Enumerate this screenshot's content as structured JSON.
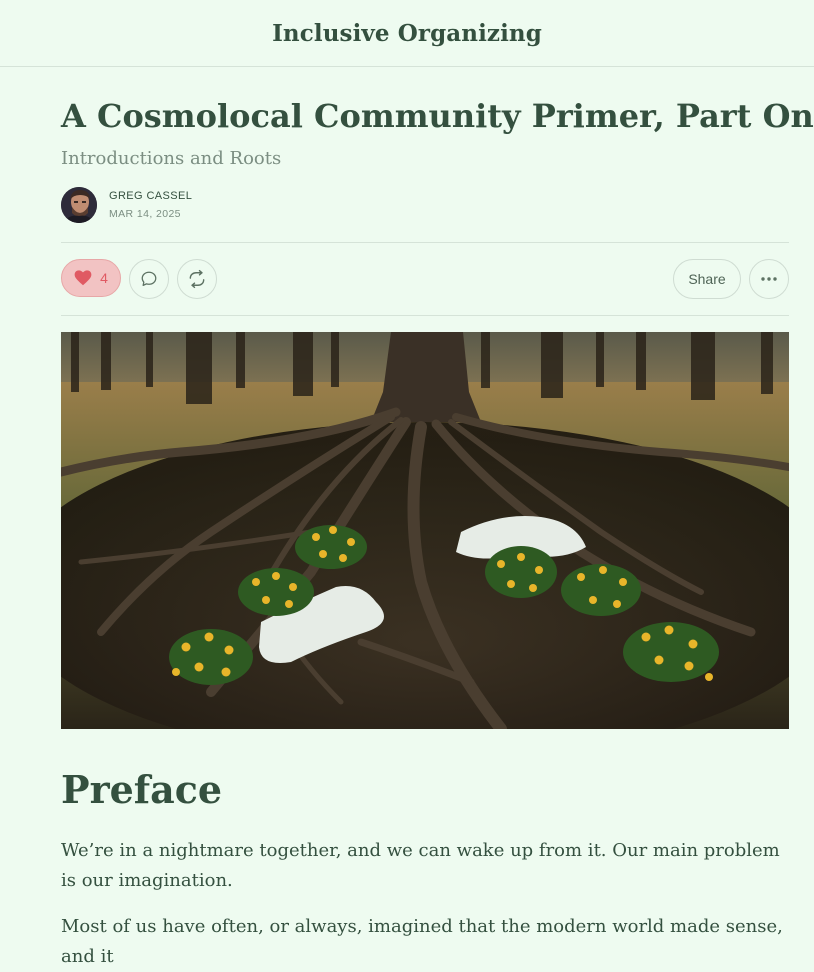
{
  "publication": {
    "name": "Inclusive Organizing"
  },
  "post": {
    "title": "A Cosmolocal Community Primer, Part One",
    "subtitle": "Introductions and Roots",
    "author": "GREG CASSEL",
    "date": "MAR 14, 2025"
  },
  "actions": {
    "like_count": "4",
    "share_label": "Share"
  },
  "body": {
    "section_heading": "Preface",
    "paragraphs": [
      "We’re in a nightmare together, and we can wake up from it. Our main problem is our imagination.",
      "Most of us have often, or always, imagined that the modern world made sense, and it"
    ]
  },
  "colors": {
    "background": "#eefbf0",
    "text": "#34503f",
    "muted": "#7b8e82",
    "like_fill": "#f2c3c3",
    "like_heart": "#e05a63"
  }
}
